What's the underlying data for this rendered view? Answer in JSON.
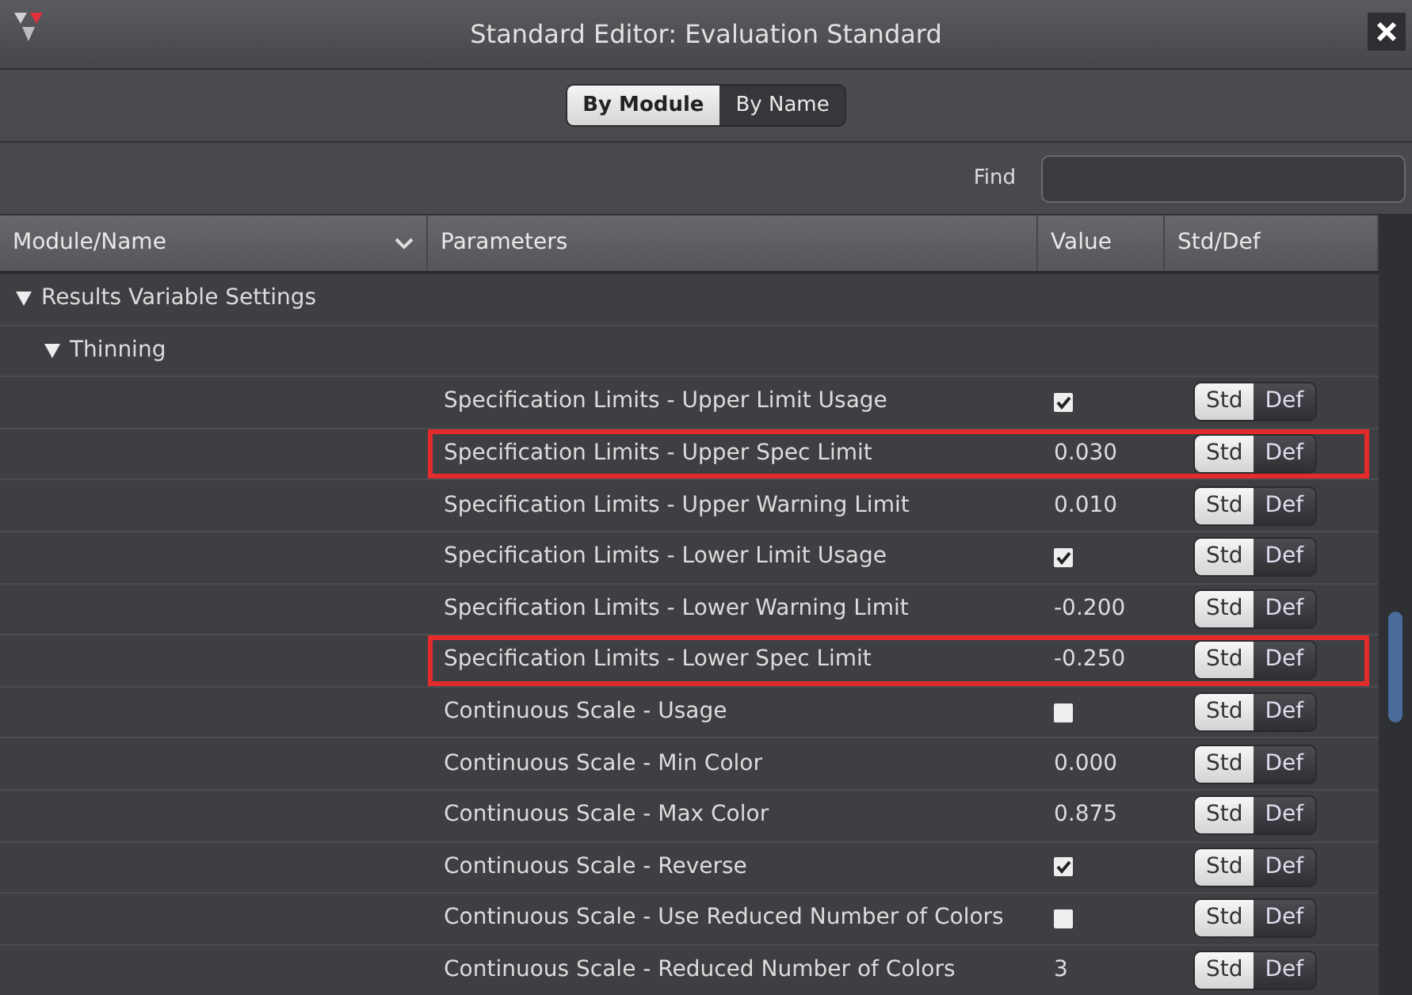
{
  "window": {
    "title": "Standard Editor: Evaluation Standard"
  },
  "view_toggle": [
    {
      "label": "By Module",
      "selected": true
    },
    {
      "label": "By Name",
      "selected": false
    }
  ],
  "find": {
    "label": "Find"
  },
  "table": {
    "columns": [
      "Module/Name",
      "Parameters",
      "Value",
      "Std/Def"
    ],
    "tree": [
      {
        "label": "Results Variable Settings",
        "expanded": true,
        "children": [
          {
            "label": "Thinning",
            "expanded": true,
            "parameters": [
              {
                "name": "Specification Limits - Upper Limit Usage",
                "kind": "checkbox",
                "checked": true,
                "highlighted": false,
                "std_def": [
                  {
                    "label": "Std",
                    "selected": true
                  },
                  {
                    "label": "Def",
                    "selected": false
                  }
                ]
              },
              {
                "name": "Specification Limits - Upper Spec Limit",
                "kind": "number",
                "value": "0.030",
                "highlighted": true,
                "std_def": [
                  {
                    "label": "Std",
                    "selected": true
                  },
                  {
                    "label": "Def",
                    "selected": false
                  }
                ]
              },
              {
                "name": "Specification Limits - Upper Warning Limit",
                "kind": "number",
                "value": "0.010",
                "highlighted": false,
                "std_def": [
                  {
                    "label": "Std",
                    "selected": true
                  },
                  {
                    "label": "Def",
                    "selected": false
                  }
                ]
              },
              {
                "name": "Specification Limits - Lower Limit Usage",
                "kind": "checkbox",
                "checked": true,
                "highlighted": false,
                "std_def": [
                  {
                    "label": "Std",
                    "selected": true
                  },
                  {
                    "label": "Def",
                    "selected": false
                  }
                ]
              },
              {
                "name": "Specification Limits - Lower Warning Limit",
                "kind": "number",
                "value": "-0.200",
                "highlighted": false,
                "std_def": [
                  {
                    "label": "Std",
                    "selected": true
                  },
                  {
                    "label": "Def",
                    "selected": false
                  }
                ]
              },
              {
                "name": "Specification Limits - Lower Spec Limit",
                "kind": "number",
                "value": "-0.250",
                "highlighted": true,
                "std_def": [
                  {
                    "label": "Std",
                    "selected": true
                  },
                  {
                    "label": "Def",
                    "selected": false
                  }
                ]
              },
              {
                "name": "Continuous Scale - Usage",
                "kind": "checkbox",
                "checked": false,
                "highlighted": false,
                "std_def": [
                  {
                    "label": "Std",
                    "selected": true
                  },
                  {
                    "label": "Def",
                    "selected": false
                  }
                ]
              },
              {
                "name": "Continuous Scale - Min Color",
                "kind": "number",
                "value": "0.000",
                "highlighted": false,
                "std_def": [
                  {
                    "label": "Std",
                    "selected": true
                  },
                  {
                    "label": "Def",
                    "selected": false
                  }
                ]
              },
              {
                "name": "Continuous Scale - Max Color",
                "kind": "number",
                "value": "0.875",
                "highlighted": false,
                "std_def": [
                  {
                    "label": "Std",
                    "selected": true
                  },
                  {
                    "label": "Def",
                    "selected": false
                  }
                ]
              },
              {
                "name": "Continuous Scale - Reverse",
                "kind": "checkbox",
                "checked": true,
                "highlighted": false,
                "std_def": [
                  {
                    "label": "Std",
                    "selected": true
                  },
                  {
                    "label": "Def",
                    "selected": false
                  }
                ]
              },
              {
                "name": "Continuous Scale - Use Reduced Number of Colors",
                "kind": "checkbox",
                "checked": false,
                "highlighted": false,
                "std_def": [
                  {
                    "label": "Std",
                    "selected": true
                  },
                  {
                    "label": "Def",
                    "selected": false
                  }
                ]
              },
              {
                "name": "Continuous Scale - Reduced Number of Colors",
                "kind": "number",
                "value": "3",
                "highlighted": false,
                "std_def": [
                  {
                    "label": "Std",
                    "selected": true
                  },
                  {
                    "label": "Def",
                    "selected": false
                  }
                ]
              }
            ]
          }
        ]
      }
    ]
  }
}
